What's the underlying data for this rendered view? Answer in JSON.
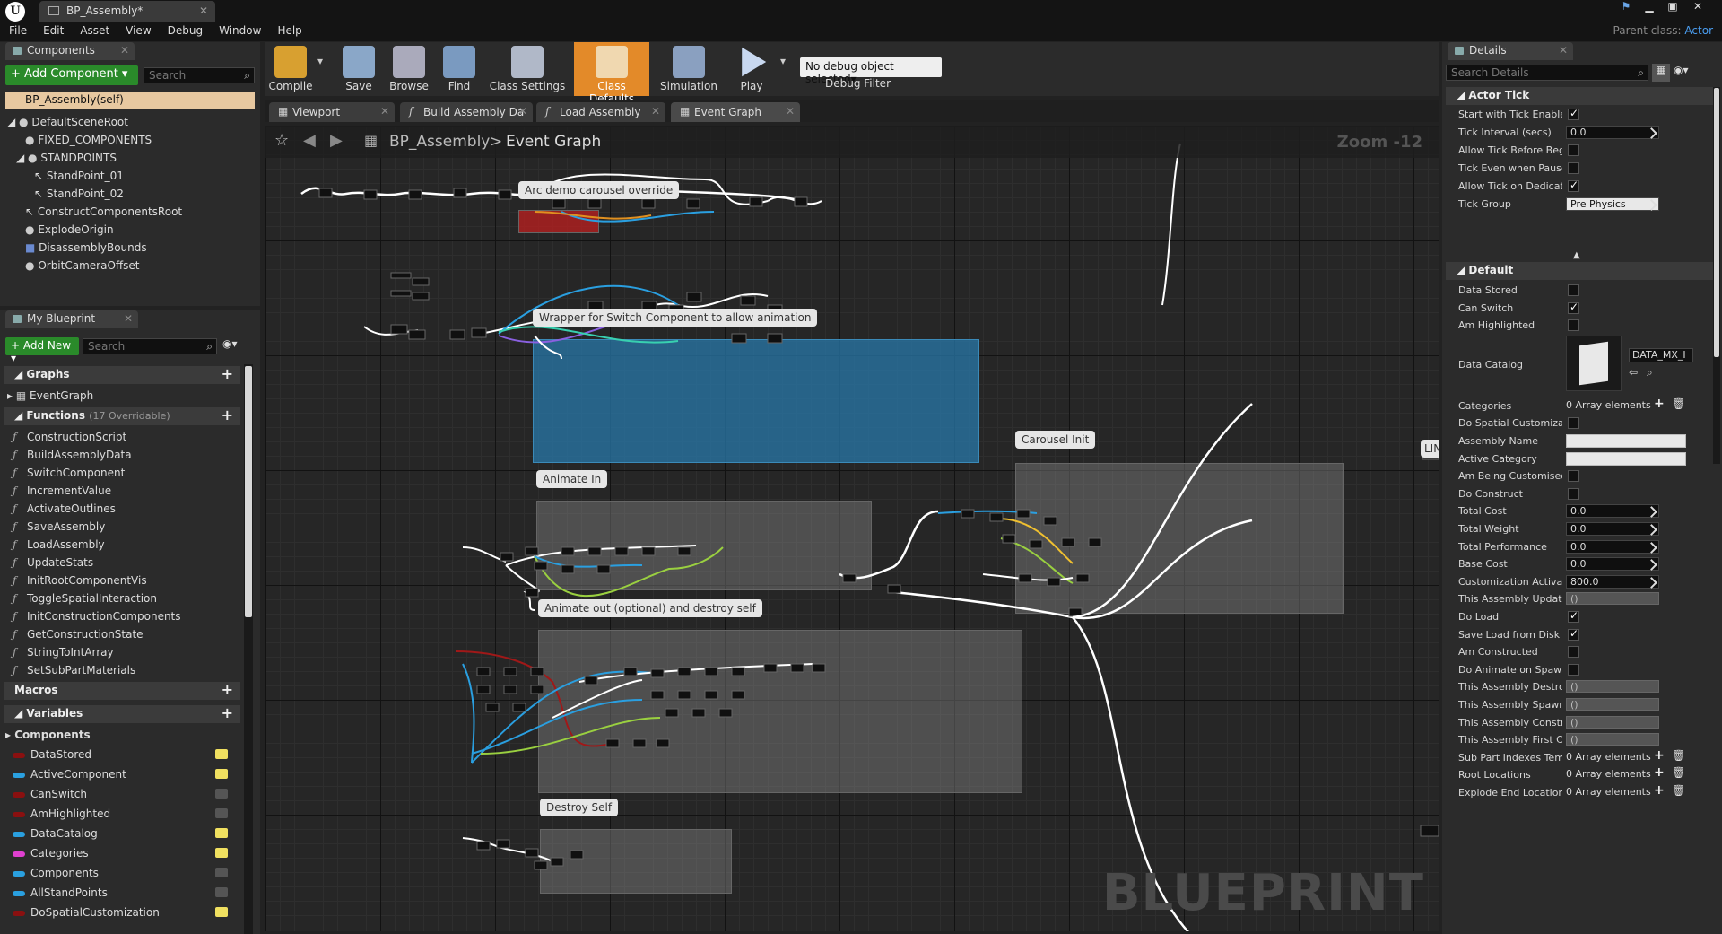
{
  "app": {
    "doc_tab": "BP_Assembly*",
    "parent_label": "Parent class:",
    "parent_value": "Actor"
  },
  "menu": [
    "File",
    "Edit",
    "Asset",
    "View",
    "Debug",
    "Window",
    "Help"
  ],
  "components": {
    "tab": "Components",
    "add_button": "+ Add Component ▾",
    "search_placeholder": "Search",
    "self": "BP_Assembly(self)",
    "tree": [
      "DefaultSceneRoot",
      "FIXED_COMPONENTS",
      "STANDPOINTS",
      "StandPoint_01",
      "StandPoint_02",
      "ConstructComponentsRoot",
      "ExplodeOrigin",
      "DisassemblyBounds",
      "OrbitCameraOffset"
    ]
  },
  "my_blueprint": {
    "tab": "My Blueprint",
    "add_new": "+ Add New ▾",
    "search_placeholder": "Search",
    "graphs_label": "Graphs",
    "event_graph": "EventGraph",
    "functions_label": "Functions",
    "functions_note": "(17 Overridable)",
    "functions": [
      "ConstructionScript",
      "BuildAssemblyData",
      "SwitchComponent",
      "IncrementValue",
      "ActivateOutlines",
      "SaveAssembly",
      "LoadAssembly",
      "UpdateStats",
      "InitRootComponentVis",
      "ToggleSpatialInteraction",
      "InitConstructionComponents",
      "GetConstructionState",
      "StringToIntArray",
      "SetSubPartMaterials"
    ],
    "macros_label": "Macros",
    "variables_label": "Variables",
    "components_cat": "Components",
    "variables": [
      {
        "name": "DataStored",
        "color": "#8a1010"
      },
      {
        "name": "ActiveComponent",
        "color": "#2aa0e0"
      },
      {
        "name": "CanSwitch",
        "color": "#8a1010"
      },
      {
        "name": "AmHighlighted",
        "color": "#8a1010"
      },
      {
        "name": "DataCatalog",
        "color": "#2aa0e0"
      },
      {
        "name": "Categories",
        "color": "#e040d0"
      },
      {
        "name": "Components",
        "color": "#2aa0e0"
      },
      {
        "name": "AllStandPoints",
        "color": "#2aa0e0"
      },
      {
        "name": "DoSpatialCustomization",
        "color": "#8a1010"
      }
    ]
  },
  "toolbar": {
    "buttons": [
      "Compile",
      "Save",
      "Browse",
      "Find",
      "Class Settings",
      "Class Defaults",
      "Simulation",
      "Play"
    ],
    "debug_select": "No debug object selected▾",
    "debug_filter": "Debug Filter"
  },
  "graph_tabs": [
    "Viewport",
    "Build Assembly Da",
    "Load Assembly",
    "Event Graph"
  ],
  "breadcrumb": {
    "root": "BP_Assembly",
    "sep": ">",
    "leaf": "Event Graph",
    "zoom": "Zoom -12"
  },
  "watermark": "BLUEPRINT",
  "comments": [
    "Arc demo carousel override",
    "Wrapper for Switch Component to allow animation",
    "Carousel Init",
    "Animate In",
    "Animate out (optional) and destroy self",
    "Destroy Self",
    "LIN"
  ],
  "details": {
    "tab": "Details",
    "search_placeholder": "Search Details",
    "actor_tick": "Actor Tick",
    "tick_rows": [
      {
        "label": "Start with Tick Enabled",
        "type": "check",
        "value": true
      },
      {
        "label": "Tick Interval (secs)",
        "type": "num",
        "value": "0.0"
      },
      {
        "label": "Allow Tick Before Begin",
        "type": "check",
        "value": false
      },
      {
        "label": "Tick Even when Paused",
        "type": "check",
        "value": false
      },
      {
        "label": "Allow Tick on Dedicated",
        "type": "check",
        "value": true
      },
      {
        "label": "Tick Group",
        "type": "select",
        "value": "Pre Physics"
      }
    ],
    "default": "Default",
    "catalog_value": "DATA_MX_I",
    "rows": [
      {
        "label": "Data Stored",
        "type": "check",
        "value": false
      },
      {
        "label": "Can Switch",
        "type": "check",
        "value": true
      },
      {
        "label": "Am Highlighted",
        "type": "check",
        "value": false
      },
      {
        "label": "Data Catalog",
        "type": "asset",
        "value": ""
      },
      {
        "label": "Categories",
        "type": "array",
        "value": "0 Array elements"
      },
      {
        "label": "Do Spatial Customization",
        "type": "check",
        "value": false
      },
      {
        "label": "Assembly Name",
        "type": "text",
        "value": ""
      },
      {
        "label": "Active Category",
        "type": "text",
        "value": ""
      },
      {
        "label": "Am Being Customised",
        "type": "check",
        "value": false
      },
      {
        "label": "Do Construct",
        "type": "check",
        "value": false
      },
      {
        "label": "Total Cost",
        "type": "num",
        "value": "0.0"
      },
      {
        "label": "Total Weight",
        "type": "num",
        "value": "0.0"
      },
      {
        "label": "Total Performance",
        "type": "num",
        "value": "0.0"
      },
      {
        "label": "Base Cost",
        "type": "num",
        "value": "0.0"
      },
      {
        "label": "Customization Activation",
        "type": "num",
        "value": "800.0"
      },
      {
        "label": "This Assembly Updated",
        "type": "ro",
        "value": "()"
      },
      {
        "label": "Do Load",
        "type": "check",
        "value": true
      },
      {
        "label": "Save Load from Disk",
        "type": "check",
        "value": true
      },
      {
        "label": "Am Constructed",
        "type": "check",
        "value": false
      },
      {
        "label": "Do Animate on Spawn",
        "type": "check",
        "value": false
      },
      {
        "label": "This Assembly Destroyed",
        "type": "ro",
        "value": "()"
      },
      {
        "label": "This Assembly Spawned",
        "type": "ro",
        "value": "()"
      },
      {
        "label": "This Assembly Constructed",
        "type": "ro",
        "value": "()"
      },
      {
        "label": "This Assembly First Cu",
        "type": "ro",
        "value": "()"
      },
      {
        "label": "Sub Part Indexes Temp",
        "type": "array",
        "value": "0 Array elements"
      },
      {
        "label": "Root Locations",
        "type": "array",
        "value": "0 Array elements"
      },
      {
        "label": "Explode End Locations",
        "type": "array",
        "value": "0 Array elements"
      }
    ]
  }
}
